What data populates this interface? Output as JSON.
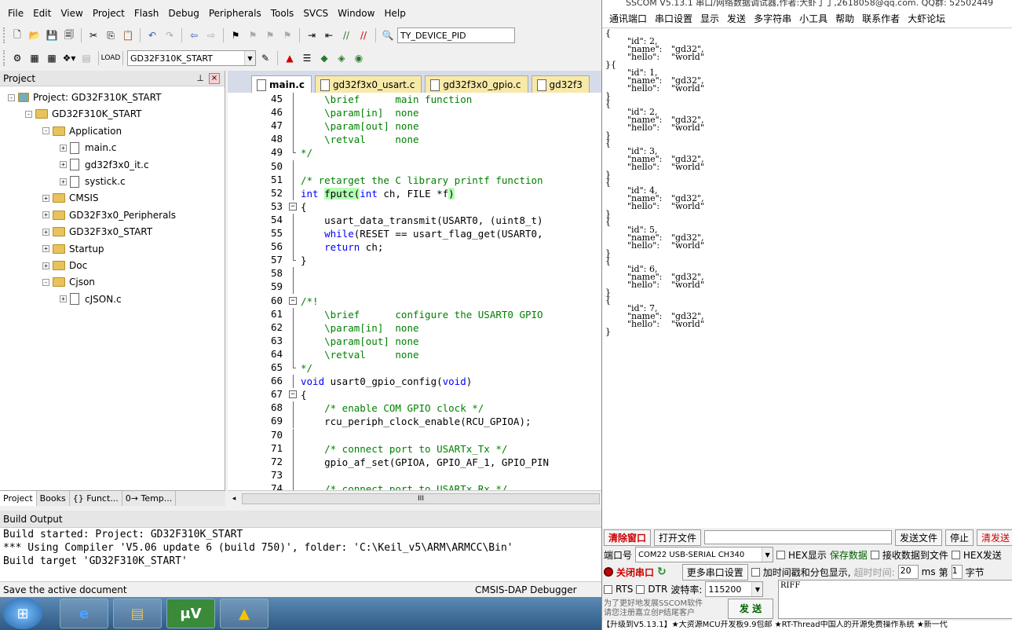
{
  "keil": {
    "menu": [
      "File",
      "Edit",
      "View",
      "Project",
      "Flash",
      "Debug",
      "Peripherals",
      "Tools",
      "SVCS",
      "Window",
      "Help"
    ],
    "toolbar": {
      "find_value": "TY_DEVICE_PID",
      "target": "GD32F310K_START"
    },
    "project_panel": {
      "title": "Project",
      "tree": [
        {
          "label": "Project: GD32F310K_START",
          "level": 0,
          "expand": "-",
          "icon": "project"
        },
        {
          "label": "GD32F310K_START",
          "level": 1,
          "expand": "-",
          "icon": "target"
        },
        {
          "label": "Application",
          "level": 2,
          "expand": "-",
          "icon": "folder"
        },
        {
          "label": "main.c",
          "level": 3,
          "expand": "+",
          "icon": "file"
        },
        {
          "label": "gd32f3x0_it.c",
          "level": 3,
          "expand": "+",
          "icon": "file"
        },
        {
          "label": "systick.c",
          "level": 3,
          "expand": "+",
          "icon": "file"
        },
        {
          "label": "CMSIS",
          "level": 2,
          "expand": "+",
          "icon": "folder"
        },
        {
          "label": "GD32F3x0_Peripherals",
          "level": 2,
          "expand": "+",
          "icon": "folder"
        },
        {
          "label": "GD32F3x0_START",
          "level": 2,
          "expand": "+",
          "icon": "folder"
        },
        {
          "label": "Startup",
          "level": 2,
          "expand": "+",
          "icon": "folder"
        },
        {
          "label": "Doc",
          "level": 2,
          "expand": "+",
          "icon": "folder"
        },
        {
          "label": "Cjson",
          "level": 2,
          "expand": "-",
          "icon": "folder"
        },
        {
          "label": "cJSON.c",
          "level": 3,
          "expand": "+",
          "icon": "file"
        }
      ],
      "tabs": [
        "Project",
        "Books",
        "{} Funct...",
        "0→ Temp..."
      ]
    },
    "editor": {
      "tabs": [
        "main.c",
        "gd32f3x0_usart.c",
        "gd32f3x0_gpio.c",
        "gd32f3"
      ],
      "lines": [
        {
          "n": "45",
          "fold": "",
          "html": "    \\brief      main function",
          "cls": "cm"
        },
        {
          "n": "46",
          "fold": "",
          "html": "    \\param[in]  none",
          "cls": "cm"
        },
        {
          "n": "47",
          "fold": "",
          "html": "    \\param[out] none",
          "cls": "cm"
        },
        {
          "n": "48",
          "fold": "",
          "html": "    \\retval     none",
          "cls": "cm"
        },
        {
          "n": "49",
          "fold": "end",
          "html": "*/",
          "cls": "cm"
        },
        {
          "n": "50",
          "fold": "",
          "html": "",
          "cls": ""
        },
        {
          "n": "51",
          "fold": "",
          "html": "/* retarget the C library printf function ",
          "cls": "cm"
        },
        {
          "n": "52",
          "fold": "",
          "html": "int fputc(int ch, FILE *f)",
          "cls": "hlline"
        },
        {
          "n": "53",
          "fold": "box",
          "html": "{",
          "cls": ""
        },
        {
          "n": "54",
          "fold": "",
          "html": "    usart_data_transmit(USART0, (uint8_t)",
          "cls": ""
        },
        {
          "n": "55",
          "fold": "",
          "html": "    while(RESET == usart_flag_get(USART0, ",
          "cls": "while"
        },
        {
          "n": "56",
          "fold": "",
          "html": "    return ch;",
          "cls": "return"
        },
        {
          "n": "57",
          "fold": "end",
          "html": "}",
          "cls": ""
        },
        {
          "n": "58",
          "fold": "",
          "html": "",
          "cls": ""
        },
        {
          "n": "59",
          "fold": "",
          "html": "",
          "cls": ""
        },
        {
          "n": "60",
          "fold": "box",
          "html": "/*!",
          "cls": "cm"
        },
        {
          "n": "61",
          "fold": "",
          "html": "    \\brief      configure the USART0 GPIO ",
          "cls": "cm"
        },
        {
          "n": "62",
          "fold": "",
          "html": "    \\param[in]  none",
          "cls": "cm"
        },
        {
          "n": "63",
          "fold": "",
          "html": "    \\param[out] none",
          "cls": "cm"
        },
        {
          "n": "64",
          "fold": "",
          "html": "    \\retval     none",
          "cls": "cm"
        },
        {
          "n": "65",
          "fold": "end",
          "html": "*/",
          "cls": "cm"
        },
        {
          "n": "66",
          "fold": "",
          "html": "void usart0_gpio_config(void)",
          "cls": "void"
        },
        {
          "n": "67",
          "fold": "box",
          "html": "{",
          "cls": ""
        },
        {
          "n": "68",
          "fold": "",
          "html": "    /* enable COM GPIO clock */",
          "cls": "cm"
        },
        {
          "n": "69",
          "fold": "",
          "html": "    rcu_periph_clock_enable(RCU_GPIOA);",
          "cls": ""
        },
        {
          "n": "70",
          "fold": "",
          "html": "",
          "cls": ""
        },
        {
          "n": "71",
          "fold": "",
          "html": "    /* connect port to USARTx_Tx */",
          "cls": "cm"
        },
        {
          "n": "72",
          "fold": "",
          "html": "    gpio_af_set(GPIOA, GPIO_AF_1, GPIO_PIN",
          "cls": ""
        },
        {
          "n": "73",
          "fold": "",
          "html": "",
          "cls": ""
        },
        {
          "n": "74",
          "fold": "",
          "html": "    /* connect port to USARTx_Rx */",
          "cls": "cm"
        }
      ]
    },
    "build_output": {
      "title": "Build Output",
      "lines": [
        "Build started: Project: GD32F310K_START",
        "*** Using Compiler 'V5.06 update 6 (build 750)', folder: 'C:\\Keil_v5\\ARM\\ARMCC\\Bin'",
        "Build target 'GD32F310K_START'"
      ]
    },
    "status": {
      "left": "Save the active document",
      "right": "CMSIS-DAP Debugger"
    }
  },
  "sscom": {
    "title": "SSCOM V5.13.1 串口/网络数据调试器,作者:大虾丁丁,2618058@qq.com. QQ群: 52502449",
    "menu": [
      "通讯端口",
      "串口设置",
      "显示",
      "发送",
      "多字符串",
      "小工具",
      "帮助",
      "联系作者",
      "大虾论坛"
    ],
    "output": "{\n\t\"id\":\t2,\n\t\"name\":\t\"gd32\",\n\t\"hello\":\t\"world\"\n}{\n\t\"id\":\t1,\n\t\"name\":\t\"gd32\",\n\t\"hello\":\t\"world\"\n}\n{\n\t\"id\":\t2,\n\t\"name\":\t\"gd32\",\n\t\"hello\":\t\"world\"\n}\n{\n\t\"id\":\t3,\n\t\"name\":\t\"gd32\",\n\t\"hello\":\t\"world\"\n}\n{\n\t\"id\":\t4,\n\t\"name\":\t\"gd32\",\n\t\"hello\":\t\"world\"\n}\n{\n\t\"id\":\t5,\n\t\"name\":\t\"gd32\",\n\t\"hello\":\t\"world\"\n}\n{\n\t\"id\":\t6,\n\t\"name\":\t\"gd32\",\n\t\"hello\":\t\"world\"\n}\n{\n\t\"id\":\t7,\n\t\"name\":\t\"gd32\",\n\t\"hello\":\t\"world\"\n}",
    "clear_btn": "清除窗口",
    "open_file_btn": "打开文件",
    "send_file_btn": "发送文件",
    "stop_btn": "停止",
    "clear_send_btn": "清发送",
    "port_label": "端口号",
    "port_value": "COM22 USB-SERIAL CH340",
    "hex_show": "HEX显示",
    "save_data": "保存数据",
    "recv_to_file": "接收数据到文件",
    "hex_send": "HEX发送",
    "close_port_btn": "关闭串口",
    "more_settings": "更多串口设置",
    "timestamp_label": "加时间戳和分包显示,",
    "timeout_label": "超时时间:",
    "timeout_value": "20",
    "ms_label": "ms",
    "nth_label": "第",
    "nth_value": "1",
    "byte_label": "字节",
    "rts": "RTS",
    "dtr": "DTR",
    "baud_label": "波特率:",
    "baud_value": "115200",
    "send_input": "RIFF",
    "promo": "为了更好地发展SSCOM软件\n请您注册嘉立创P结尾客户",
    "send_btn": "发 送",
    "ticker": "【升级到V5.13.1】★大资源MCU开发板9.9包邮 ★RT-Thread中国人的开源免费操作系统 ★新一代"
  }
}
